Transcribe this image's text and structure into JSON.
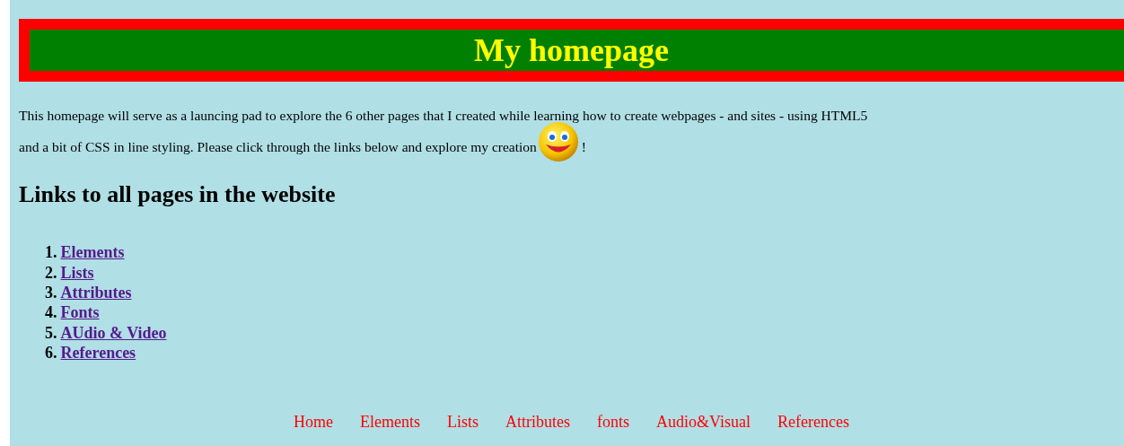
{
  "header": {
    "title": "My homepage"
  },
  "intro": {
    "lines": [
      "This homepage will serve as a launcing pad to explore the 6 other pages that I created while learning how to create webpages - and sites - using HTML5",
      "and a bit of CSS in line styling. Please click through the links below and explore my creation"
    ],
    "after": "!"
  },
  "links_heading": "Links to all pages in the website",
  "links": [
    {
      "number": "1.",
      "label": "Elements"
    },
    {
      "number": "2.",
      "label": "Lists"
    },
    {
      "number": "3.",
      "label": "Attributes"
    },
    {
      "number": "4.",
      "label": "Fonts"
    },
    {
      "number": "5.",
      "label": "AUdio & Video"
    },
    {
      "number": "6.",
      "label": "References"
    }
  ],
  "footer_nav": [
    "Home",
    "Elements",
    "Lists",
    "Attributes",
    "fonts",
    "Audio&Visual",
    "References"
  ]
}
